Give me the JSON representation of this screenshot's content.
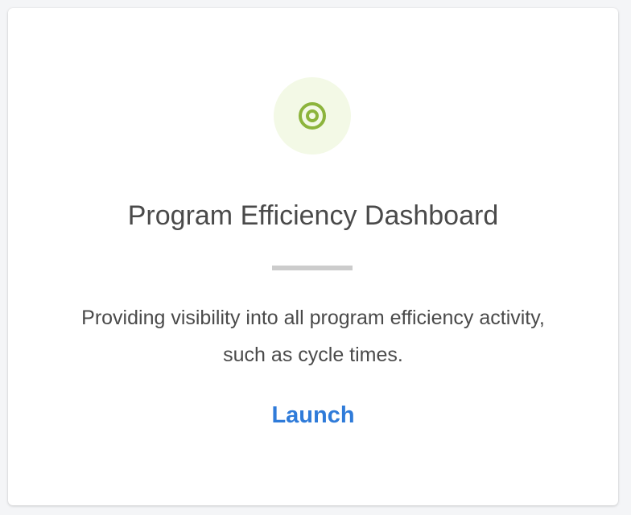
{
  "card": {
    "icon": "target-icon",
    "title": "Program Efficiency Dashboard",
    "description": "Providing visibility into all program efficiency activity, such as cycle times.",
    "action_label": "Launch"
  },
  "colors": {
    "icon_color": "#8cb43c",
    "icon_bg": "#f3f9e6",
    "link": "#2f7bd9",
    "text": "#4a4a4a",
    "divider": "#cccccc"
  }
}
